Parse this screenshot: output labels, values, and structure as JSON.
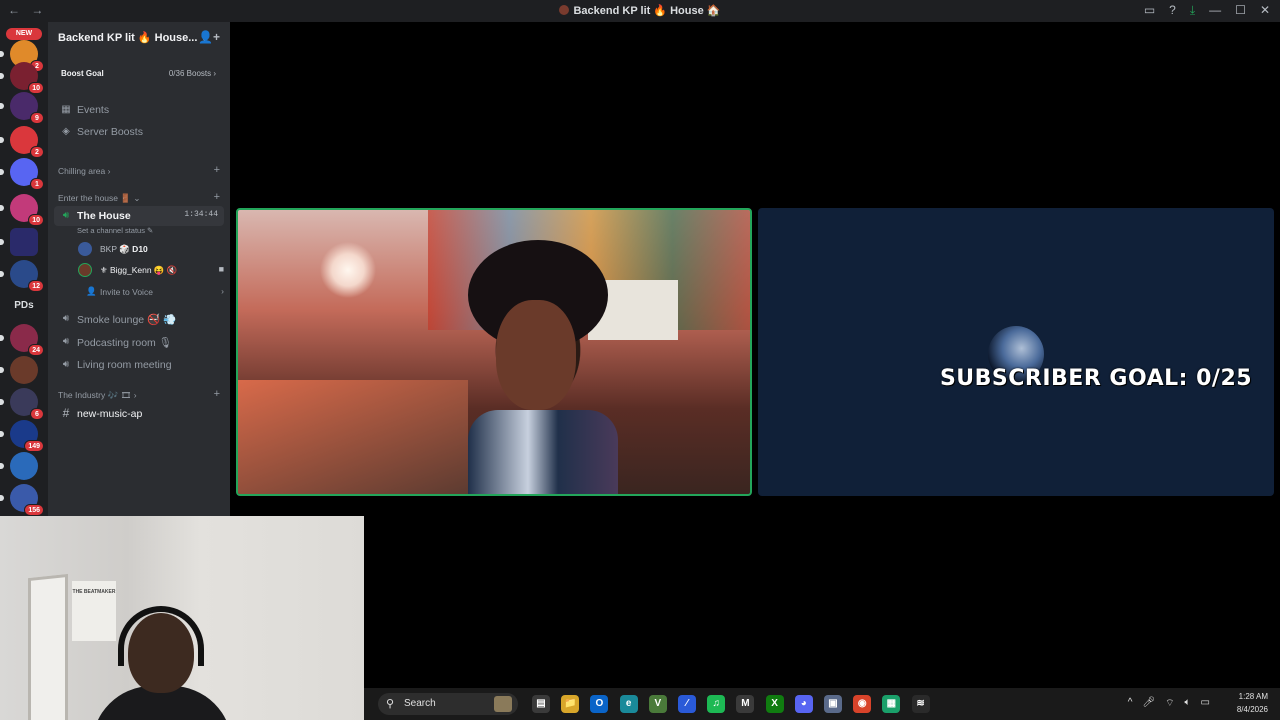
{
  "window": {
    "title": "Backend KP lit 🔥 House 🏠",
    "nav_arrows": "← →",
    "controls": [
      "▭",
      "?",
      "⤓",
      "—",
      "☐",
      "✕"
    ]
  },
  "servers": [
    {
      "badge": "NEW",
      "count": "2",
      "color": "#e08a2a"
    },
    {
      "count": "10",
      "color": "#7a2030"
    },
    {
      "count": "9",
      "color": "#4a2a6a"
    },
    {
      "count": "2",
      "color": "#da373c"
    },
    {
      "count": "1",
      "color": "#5865f2"
    },
    {
      "count": "10",
      "color": "#c23a7a"
    },
    {
      "count": "",
      "color": "#2a2a6a"
    },
    {
      "count": "12",
      "color": "#2a4a8a"
    },
    {
      "text": "PDs"
    },
    {
      "count": "24",
      "color": "#8a2a4a"
    },
    {
      "count": "",
      "color": "#6a3a2a"
    },
    {
      "count": "6",
      "color": "#3a3a5a"
    },
    {
      "count": "149",
      "color": "#1a3a8a"
    },
    {
      "count": "",
      "color": "#2a6aba"
    },
    {
      "count": "156",
      "color": "#3a5aaa"
    }
  ],
  "sidebar": {
    "guild_name": "Backend KP lit 🔥 House...",
    "boost": {
      "label": "Boost Goal",
      "progress": "0/36 Boosts"
    },
    "events": "Events",
    "server_boosts": "Server Boosts",
    "cat_chilling": "Chilling area",
    "cat_enter": "Enter the house 🚪",
    "house_channel": "The House",
    "house_timer": "1:34:44",
    "status_hint": "Set a channel status ✎",
    "voice_users": [
      {
        "name": "BKP",
        "tag": "🎲 D10",
        "color": "#3a5a9a"
      },
      {
        "name": "⚜ Bigg_Kenn 😝 🔇",
        "tag": "",
        "color": "#6a3a2a"
      }
    ],
    "invite": "Invite to Voice",
    "smoke": "Smoke lounge 🚭 💨",
    "podcast": "Podcasting room 🎙",
    "living": "Living room meeting",
    "cat_industry": "The Industry 🎶 🎞",
    "music_channel": "new-music-ap"
  },
  "webcam": {
    "poster_text": "THE BEATMAKER"
  },
  "stream": {
    "overlay_text": "SUBSCRIBER GOAL: 0/25"
  },
  "taskbar": {
    "search_placeholder": "Search",
    "apps": [
      {
        "name": "task-view",
        "glyph": "▤",
        "color": "#3a3a3a"
      },
      {
        "name": "file-explorer",
        "glyph": "📁",
        "color": "#d8a62a"
      },
      {
        "name": "outlook",
        "glyph": "O",
        "color": "#0a64c8"
      },
      {
        "name": "edge",
        "glyph": "e",
        "color": "#1a8a9a"
      },
      {
        "name": "vectorworks",
        "glyph": "V",
        "color": "#4a7a3a"
      },
      {
        "name": "app-blue",
        "glyph": "⁄",
        "color": "#2a5ad8"
      },
      {
        "name": "spotify",
        "glyph": "♫",
        "color": "#1db954"
      },
      {
        "name": "gmail",
        "glyph": "M",
        "color": "#3a3a3a"
      },
      {
        "name": "xbox",
        "glyph": "X",
        "color": "#107c10"
      },
      {
        "name": "discord",
        "glyph": "◕",
        "color": "#5865f2"
      },
      {
        "name": "app-white",
        "glyph": "▣",
        "color": "#5a6a8a"
      },
      {
        "name": "chrome",
        "glyph": "◉",
        "color": "#d8432a"
      },
      {
        "name": "app-green",
        "glyph": "▦",
        "color": "#1aa06a"
      },
      {
        "name": "app-wave",
        "glyph": "≋",
        "color": "#2a2a2a"
      }
    ],
    "time": "1:28 AM",
    "date": "8/4/2026"
  }
}
